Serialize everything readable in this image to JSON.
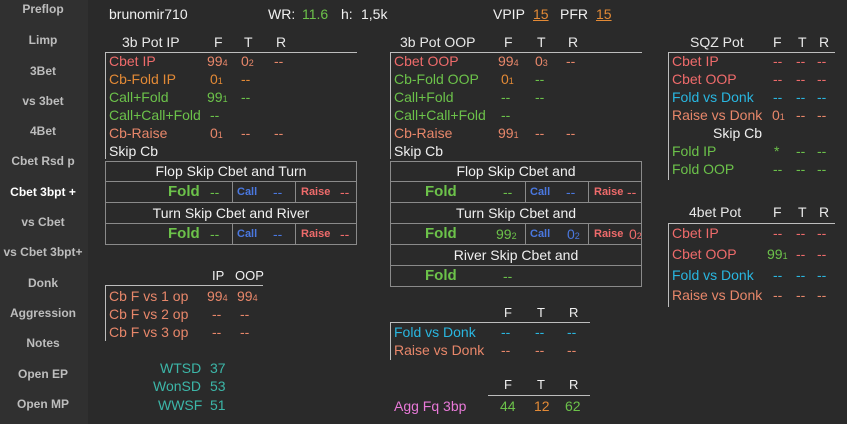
{
  "sidebar": {
    "items": [
      "Preflop",
      "Limp",
      "3Bet",
      "vs 3bet",
      "4Bet",
      "Cbet Rsd p",
      "Cbet 3bpt +",
      "vs Cbet",
      "vs Cbet 3bpt+",
      "Donk",
      "Aggression",
      "Notes",
      "Open EP",
      "Open MP"
    ]
  },
  "header": {
    "player": "brunomir710",
    "wr_label": "WR:",
    "wr_value": "11.6",
    "h_label": "h:",
    "h_value": "1,5k",
    "vpip_label": "VPIP",
    "vpip_value": "15",
    "pfr_label": "PFR",
    "pfr_value": "15"
  },
  "ip": {
    "title": "3b  Pot IP",
    "col_f": "F",
    "col_t": "T",
    "col_r": "R",
    "rows": [
      {
        "label": "Cbet IP",
        "f": "99",
        "fs": "4",
        "t": "0",
        "ts": "2",
        "r": "--"
      },
      {
        "label": "Cb-Fold IP",
        "f": "0",
        "fs": "1",
        "t": "--",
        "r": ""
      },
      {
        "label": "Call+Fold",
        "f": "99",
        "fs": "1",
        "t": "--",
        "r": ""
      },
      {
        "label": "Call+Call+Fold",
        "f": "--",
        "fs": "",
        "t": "",
        "r": ""
      },
      {
        "label": "Cb-Raise",
        "f": "0",
        "fs": "1",
        "t": "--",
        "r": "--"
      }
    ],
    "skip_cb": "Skip Cb",
    "flop_title": "Flop Skip Cbet and Turn",
    "turn_title": "Turn Skip Cbet and River",
    "fold": "Fold",
    "fold_val": "--",
    "call": "Call",
    "call_val": "--",
    "raise": "Raise",
    "raise_val": "--",
    "fold2_val": "--",
    "call2_val": "--",
    "raise2_val": "--"
  },
  "oop": {
    "title": "3b  Pot OOP",
    "col_f": "F",
    "col_t": "T",
    "col_r": "R",
    "rows": [
      {
        "label": "Cbet OOP",
        "f": "99",
        "fs": "4",
        "t": "0",
        "ts": "3",
        "r": "--"
      },
      {
        "label": "Cb-Fold OOP",
        "f": "0",
        "fs": "1",
        "t": "--",
        "r": ""
      },
      {
        "label": "Call+Fold",
        "f": "--",
        "fs": "",
        "t": "--",
        "r": ""
      },
      {
        "label": "Call+Call+Fold",
        "f": "--",
        "fs": "",
        "t": "",
        "r": ""
      },
      {
        "label": "Cb-Raise",
        "f": "99",
        "fs": "1",
        "t": "--",
        "r": "--"
      }
    ],
    "skip_cb": "Skip Cb",
    "flop_title": "Flop Skip Cbet and",
    "turn_title": "Turn Skip Cbet and",
    "river_title": "River Skip Cbet and",
    "fold": "Fold",
    "call": "Call",
    "raise": "Raise",
    "flop_fold_val": "--",
    "flop_call_val": "--",
    "flop_raise_val": "--",
    "turn_fold_val": "99",
    "turn_fold_sub": "2",
    "turn_call_val": "0",
    "turn_call_sub": "2",
    "turn_raise_val": "0",
    "turn_raise_sub": "2",
    "river_fold_val": "--"
  },
  "sqz": {
    "title": "SQZ Pot",
    "col_f": "F",
    "col_t": "T",
    "col_r": "R",
    "rows": [
      {
        "label": "Cbet IP",
        "f": "--",
        "t": "--",
        "r": "--"
      },
      {
        "label": "Cbet OOP",
        "f": "--",
        "t": "--",
        "r": "--"
      },
      {
        "label": "Fold vs Donk",
        "f": "--",
        "t": "--",
        "r": "--"
      },
      {
        "label": "Raise vs Donk",
        "f": "0",
        "fs": "1",
        "t": "--",
        "r": "--"
      }
    ],
    "skip_cb": "Skip Cb",
    "skip_rows": [
      {
        "label": "Fold IP",
        "f": "*",
        "t": "--",
        "r": "--"
      },
      {
        "label": "Fold OOP",
        "f": "--",
        "t": "--",
        "r": "--"
      }
    ]
  },
  "fourbet": {
    "title": "4bet Pot",
    "col_f": "F",
    "col_t": "T",
    "col_r": "R",
    "rows": [
      {
        "label": "Cbet IP",
        "f": "--",
        "t": "--",
        "r": "--"
      },
      {
        "label": "Cbet OOP",
        "f": "99",
        "fs": "1",
        "t": "--",
        "r": "--"
      },
      {
        "label": "Fold vs Donk",
        "f": "--",
        "t": "--",
        "r": "--"
      },
      {
        "label": "Raise vs Donk",
        "f": "--",
        "t": "--",
        "r": "--"
      }
    ]
  },
  "cbf": {
    "col_ip": "IP",
    "col_oop": "OOP",
    "rows": [
      {
        "label": "Cb F vs 1 op",
        "ip": "99",
        "ips": "4",
        "oop": "99",
        "oops": "4"
      },
      {
        "label": "Cb F vs 2 op",
        "ip": "--",
        "oop": "--"
      },
      {
        "label": "Cb F vs 3 op",
        "ip": "--",
        "oop": "--"
      }
    ]
  },
  "showdown": {
    "wtsd_label": "WTSD",
    "wtsd": "37",
    "wonsd_label": "WonSD",
    "wonsd": "53",
    "wwsf_label": "WWSF",
    "wwsf": "51"
  },
  "donk": {
    "col_f": "F",
    "col_t": "T",
    "col_r": "R",
    "rows": [
      {
        "label": "Fold vs Donk",
        "f": "--",
        "t": "--",
        "r": "--"
      },
      {
        "label": "Raise vs Donk",
        "f": "--",
        "t": "--",
        "r": "--"
      }
    ]
  },
  "agg": {
    "col_f": "F",
    "col_t": "T",
    "col_r": "R",
    "label": "Agg Fq 3bp",
    "f": "44",
    "t": "12",
    "r": "62"
  }
}
